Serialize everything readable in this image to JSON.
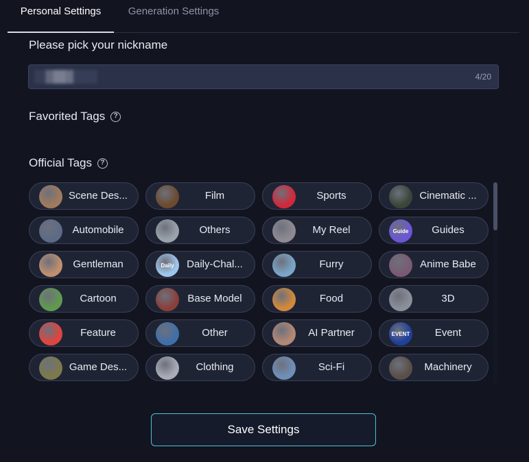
{
  "tabs": {
    "personal": "Personal Settings",
    "generation": "Generation Settings"
  },
  "nickname": {
    "label": "Please pick your nickname",
    "value": "",
    "counter": "4/20"
  },
  "favorited": {
    "label": "Favorited Tags"
  },
  "official": {
    "label": "Official Tags",
    "tags": [
      {
        "label": "Scene Des...",
        "thumb_color": "#a07a5c",
        "thumb_text": ""
      },
      {
        "label": "Film",
        "thumb_color": "#6b4a2e",
        "thumb_text": ""
      },
      {
        "label": "Sports",
        "thumb_color": "#d3283a",
        "thumb_text": ""
      },
      {
        "label": "Cinematic ...",
        "thumb_color": "#3b4538",
        "thumb_text": ""
      },
      {
        "label": "Automobile",
        "thumb_color": "#5d6a86",
        "thumb_text": ""
      },
      {
        "label": "Others",
        "thumb_color": "#9aa2ab",
        "thumb_text": ""
      },
      {
        "label": "My Reel",
        "thumb_color": "#8f8a92",
        "thumb_text": ""
      },
      {
        "label": "Guides",
        "thumb_color": "#6a56d6",
        "thumb_text": "Guide"
      },
      {
        "label": "Gentleman",
        "thumb_color": "#c08f6e",
        "thumb_text": ""
      },
      {
        "label": "Daily-Chal...",
        "thumb_color": "#9fc6ea",
        "thumb_text": "Daily"
      },
      {
        "label": "Furry",
        "thumb_color": "#7aa5c9",
        "thumb_text": ""
      },
      {
        "label": "Anime Babe",
        "thumb_color": "#7a5a72",
        "thumb_text": ""
      },
      {
        "label": "Cartoon",
        "thumb_color": "#5f9a4e",
        "thumb_text": ""
      },
      {
        "label": "Base Model",
        "thumb_color": "#8a3f3a",
        "thumb_text": ""
      },
      {
        "label": "Food",
        "thumb_color": "#d4893a",
        "thumb_text": ""
      },
      {
        "label": "3D",
        "thumb_color": "#8b8f99",
        "thumb_text": ""
      },
      {
        "label": "Feature",
        "thumb_color": "#e0443e",
        "thumb_text": ""
      },
      {
        "label": "Other",
        "thumb_color": "#3f6fa8",
        "thumb_text": ""
      },
      {
        "label": "AI Partner",
        "thumb_color": "#b48874",
        "thumb_text": ""
      },
      {
        "label": "Event",
        "thumb_color": "#1f3f9a",
        "thumb_text": "EVENT"
      },
      {
        "label": "Game Des...",
        "thumb_color": "#7c7a4a",
        "thumb_text": ""
      },
      {
        "label": "Clothing",
        "thumb_color": "#a9acb6",
        "thumb_text": ""
      },
      {
        "label": "Sci-Fi",
        "thumb_color": "#6f8fb8",
        "thumb_text": ""
      },
      {
        "label": "Machinery",
        "thumb_color": "#5a4f48",
        "thumb_text": ""
      }
    ]
  },
  "save_button": "Save Settings"
}
